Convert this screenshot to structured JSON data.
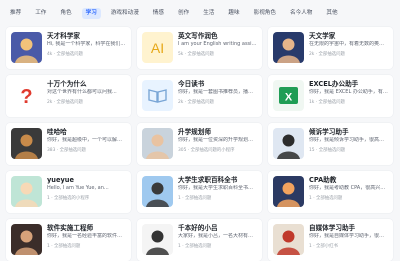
{
  "tabs": [
    "推荐",
    "工作",
    "角色",
    "学习",
    "游戏和动漫",
    "情感",
    "创作",
    "生活",
    "趣味",
    "影视角色",
    "名今人物",
    "其他"
  ],
  "active_tab": 3,
  "cards": [
    {
      "title": "天才科学家",
      "desc": "Hi, 我是一个科学家，科学在我们...",
      "meta": "4k · 全部抽选问题",
      "icon": "scientist-avatar-icon",
      "colors": [
        "#4a5aa8",
        "#f2c27a"
      ]
    },
    {
      "title": "英文写作润色",
      "desc": "I am your English writing assistant...",
      "meta": "5k · 全部抽选问题",
      "icon": "ai-writing-icon",
      "colors": [
        "#fff3cf",
        "#e6a818"
      ]
    },
    {
      "title": "天文学家",
      "desc": "在无限的宇宙中，有着无数的奥秘...",
      "meta": "2k · 全部抽选问题",
      "icon": "astronomer-avatar-icon",
      "colors": [
        "#283a6b",
        "#e7b58a"
      ]
    },
    {
      "title": "十万个为什么",
      "desc": "对这个世界有什么都可以问我...",
      "meta": "2k · 全部抽选问题",
      "icon": "question-mark-icon",
      "colors": [
        "#ffffff",
        "#e03a2e"
      ]
    },
    {
      "title": "今日读书",
      "desc": "你好，我是一套图书推荐员，播长...",
      "meta": "2k · 全部抽选问题",
      "icon": "book-icon",
      "colors": [
        "#e8f3ff",
        "#7aa6d6"
      ]
    },
    {
      "title": "EXCEL办公助手",
      "desc": "你好，我是 EXCEL 办公助手，有什...",
      "meta": "1k · 全部抽选问题",
      "icon": "excel-icon",
      "colors": [
        "#1f9d55",
        "#ffffff"
      ]
    },
    {
      "title": "哇哈哈",
      "desc": "你好，我是超级中，一个可以解决...",
      "meta": "383 · 全部抽选问题",
      "icon": "hedgehog-avatar-icon",
      "colors": [
        "#3a3a3a",
        "#c98b4a"
      ]
    },
    {
      "title": "升学规划师",
      "desc": "你好，我是一位资深的升学规划师...",
      "meta": "305 · 全部抽选问题的小程序",
      "icon": "man-avatar-icon",
      "colors": [
        "#c9d3dc",
        "#e9c3a1"
      ]
    },
    {
      "title": "倾诉学习助手",
      "desc": "你好，我是倾诉学习助手，很高兴...",
      "meta": "15 · 全部抽选问题",
      "icon": "girl-avatar-icon",
      "colors": [
        "#dfe7f2",
        "#2c2c2c"
      ]
    },
    {
      "title": "yueyue",
      "desc": "Hello, I am Yue Yue, an...",
      "meta": "1 · 全部抽选的小程序",
      "icon": "anime-girl-avatar-icon",
      "colors": [
        "#bfe5d6",
        "#f7d9b6"
      ]
    },
    {
      "title": "大学生求职百科全书",
      "desc": "你好，我是大学生求职百科全书，...",
      "meta": "1 · 全部抽选问题",
      "icon": "student-avatar-icon",
      "colors": [
        "#9fc9ef",
        "#3a3a3a"
      ]
    },
    {
      "title": "CPA助教",
      "desc": "你好，我是考助教 CPA，很高兴认识...",
      "meta": "1 · 全部抽选问题",
      "icon": "sunset-avatar-icon",
      "colors": [
        "#2b3a63",
        "#f3a35e"
      ]
    },
    {
      "title": "软件实施工程师",
      "desc": "你好，我是一名经验丰富的软件实...",
      "meta": "1 · 全部抽选问题",
      "icon": "engineer-avatar-icon",
      "colors": [
        "#3b2d2a",
        "#d7a27a"
      ]
    },
    {
      "title": "千本好的小吕",
      "desc": "大家好，我是小吕，一名大材有要...",
      "meta": "1 · 全部抽选问题",
      "icon": "girl-sketch-avatar-icon",
      "colors": [
        "#f4f4f4",
        "#333333"
      ]
    },
    {
      "title": "自媒体学习助手",
      "desc": "你好，我是自媒体学习助手，很高兴...",
      "meta": "1 · 全部小红书",
      "icon": "media-avatar-icon",
      "colors": [
        "#e9dfd2",
        "#c0392b"
      ]
    }
  ]
}
